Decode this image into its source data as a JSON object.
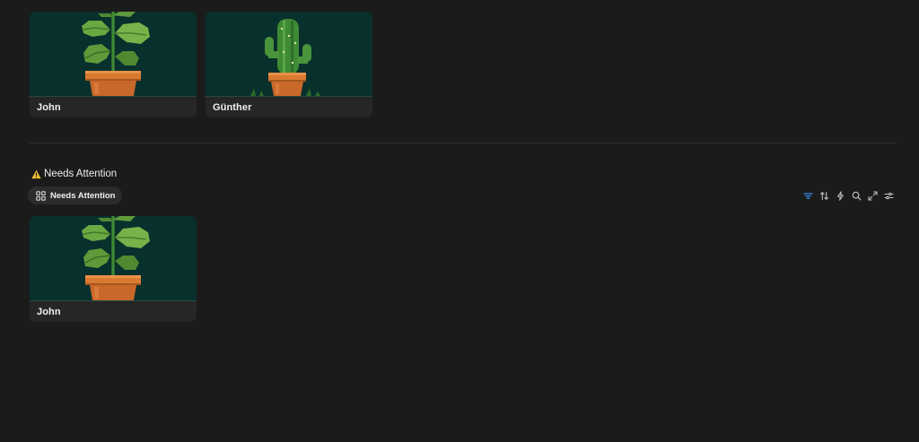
{
  "cards_top": [
    {
      "title": "John",
      "image": "pixel-art-leafy-plant-in-pot"
    },
    {
      "title": "Günther",
      "image": "pixel-art-cactus-in-pot"
    }
  ],
  "section": {
    "heading": "Needs Attention",
    "heading_icon": "warning-icon",
    "view_tab": {
      "label": "Needs Attention",
      "icon": "grid-icon"
    }
  },
  "toolbar": {
    "icons": [
      "filter-icon",
      "sort-icon",
      "bolt-icon",
      "search-icon",
      "expand-icon",
      "settings-sliders-icon"
    ],
    "active": "filter-icon"
  },
  "cards_attention": [
    {
      "title": "John",
      "image": "pixel-art-leafy-plant-in-pot"
    }
  ],
  "colors": {
    "background": "#1b1b1b",
    "card": "#262626",
    "image_bg": "#08302c",
    "accent": "#3b8ef0",
    "warning": "#f2c230"
  }
}
